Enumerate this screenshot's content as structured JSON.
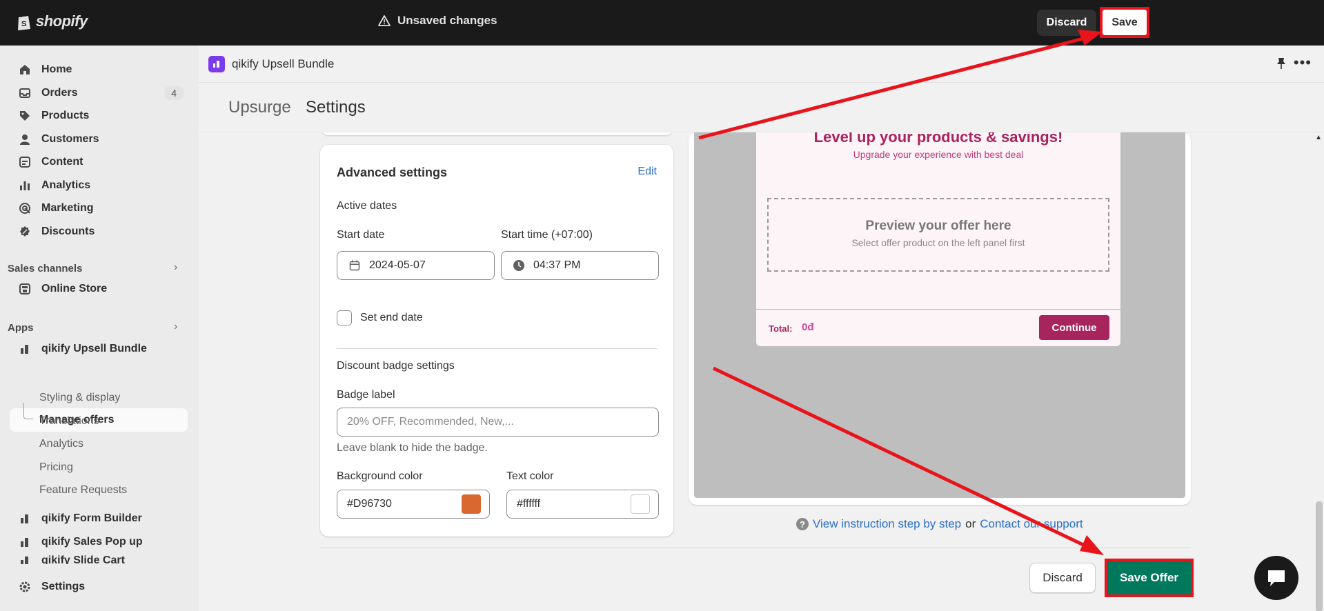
{
  "topbar": {
    "logo_text": "shopify",
    "unsaved_text": "Unsaved changes",
    "discard_label": "Discard",
    "save_label": "Save"
  },
  "sidebar": {
    "items": [
      {
        "label": "Home",
        "icon": "home-icon"
      },
      {
        "label": "Orders",
        "icon": "inbox-icon",
        "badge": "4"
      },
      {
        "label": "Products",
        "icon": "tag-icon"
      },
      {
        "label": "Customers",
        "icon": "person-icon"
      },
      {
        "label": "Content",
        "icon": "content-icon"
      },
      {
        "label": "Analytics",
        "icon": "bar-chart-icon"
      },
      {
        "label": "Marketing",
        "icon": "target-icon"
      },
      {
        "label": "Discounts",
        "icon": "discount-icon"
      }
    ],
    "sales_channels_label": "Sales channels",
    "online_store_label": "Online Store",
    "apps_label": "Apps",
    "app_name": "qikify Upsell Bundle",
    "manage_offers_label": "Manage offers",
    "sub_items": [
      "Styling & display",
      "Translations",
      "Analytics",
      "Pricing",
      "Feature Requests"
    ],
    "other_apps": [
      "qikify Form Builder",
      "qikify Sales Pop up",
      "qikify Slide Cart"
    ],
    "settings_label": "Settings"
  },
  "app_header": {
    "title": "qikify Upsell Bundle"
  },
  "page": {
    "breadcrumb": "Upsurge",
    "title": "Settings"
  },
  "advanced": {
    "title": "Advanced settings",
    "edit_label": "Edit",
    "active_dates_label": "Active dates",
    "start_date_label": "Start date",
    "start_date_value": "2024-05-07",
    "start_time_label": "Start time (+07:00)",
    "start_time_value": "04:37 PM",
    "set_end_date_label": "Set end date",
    "badge_section_label": "Discount badge settings",
    "badge_label_label": "Badge label",
    "badge_placeholder": "20% OFF, Recommended, New,...",
    "badge_hint": "Leave blank to hide the badge.",
    "bg_color_label": "Background color",
    "bg_color_value": "#D96730",
    "text_color_label": "Text color",
    "text_color_value": "#ffffff"
  },
  "preview": {
    "popup_title": "Level up your products & savings!",
    "popup_subtitle": "Upgrade your experience with best deal",
    "offer_title": "Preview your offer here",
    "offer_subtitle": "Select offer product on the left panel first",
    "total_label": "Total:",
    "total_value": "0đ",
    "continue_label": "Continue"
  },
  "instructions": {
    "link1": "View instruction step by step",
    "or_text": "or",
    "link2": "Contact our support"
  },
  "footer": {
    "discard_label": "Discard",
    "save_label": "Save Offer"
  },
  "colors": {
    "accent_red": "#e8141b",
    "save_green": "#00785c",
    "popup_pink": "#a8245c"
  }
}
